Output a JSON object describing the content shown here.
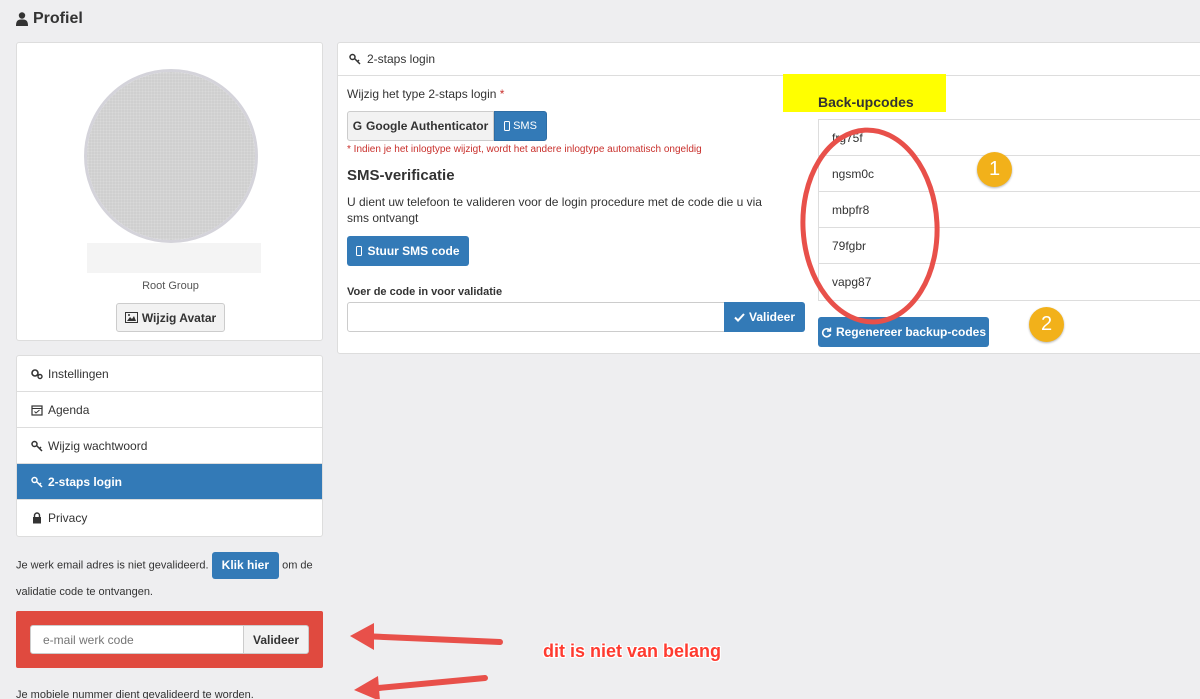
{
  "page": {
    "title": "Profiel"
  },
  "profile": {
    "group": "Root Group",
    "avatar_button": "Wijzig Avatar"
  },
  "nav": {
    "items": [
      {
        "label": "Instellingen",
        "icon": "gears-icon"
      },
      {
        "label": "Agenda",
        "icon": "calendar-icon"
      },
      {
        "label": "Wijzig wachtwoord",
        "icon": "key-icon"
      },
      {
        "label": "2-staps login",
        "icon": "key-icon",
        "active": true
      },
      {
        "label": "Privacy",
        "icon": "lock-icon"
      }
    ]
  },
  "email_validation": {
    "text_before": "Je werk email adres is niet gevalideerd.",
    "button": "Klik hier",
    "text_after": "om de validatie code te ontvangen.",
    "input_placeholder": "e-mail werk code",
    "validate_button": "Valideer",
    "mobile_note": "Je mobiele nummer dient gevalideerd te worden."
  },
  "two_step": {
    "panel_title": "2-staps login",
    "type_label": "Wijzig het type 2-staps login",
    "required_mark": "*",
    "options": {
      "google": "Google Authenticator",
      "sms": "SMS"
    },
    "selected": "SMS",
    "warning": "* Indien je het inlogtype wijzigt, wordt het andere inlogtype automatisch ongeldig",
    "sms_title": "SMS-verificatie",
    "sms_description": "U dient uw telefoon te valideren voor de login procedure met de code die u via sms ontvangt",
    "send_button": "Stuur SMS code",
    "code_label": "Voer de code in voor validatie",
    "code_value": "",
    "validate_button": "Valideer"
  },
  "backup": {
    "title": "Back-upcodes",
    "codes": [
      "frg75f",
      "ngsm0c",
      "mbpfr8",
      "79fgbr",
      "vapg87"
    ],
    "regen_button": "Regenereer backup-codes"
  },
  "annotations": {
    "badge_1": "1",
    "badge_2": "2",
    "note": "dit is niet van belang",
    "colors": {
      "circle": "#e8504a",
      "arrow": "#e8504a",
      "badge": "#f2b11a",
      "highlight": "#ffff00"
    }
  },
  "colors": {
    "primary": "#337ab7",
    "danger": "#e04a3f",
    "background": "#eeeef0"
  }
}
